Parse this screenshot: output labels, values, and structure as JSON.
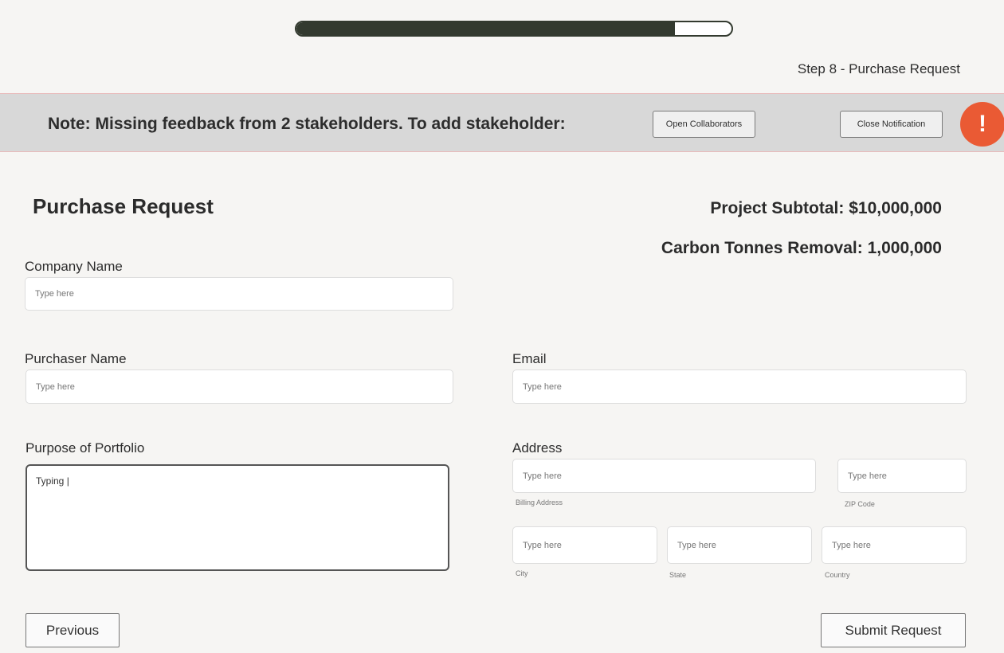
{
  "progress": {
    "fraction": 0.87
  },
  "step_label": "Step 8 - Purchase Request",
  "notification": {
    "text": "Note: Missing feedback from 2 stakeholders. To add stakeholder:",
    "open_collaborators": "Open Collaborators",
    "close_notification": "Close Notification",
    "alert_glyph": "!",
    "alert_icon": "exclamation-icon",
    "alert_color": "#ea5a34"
  },
  "form": {
    "title": "Purchase Request",
    "subtotal": "Project Subtotal: $10,000,000",
    "carbon": "Carbon Tonnes Removal: 1,000,000",
    "company_label": "Company Name",
    "purchaser_label": "Purchaser Name",
    "email_label": "Email",
    "purpose_label": "Purpose of Portfolio",
    "purpose_value": "Typing |",
    "address_label": "Address",
    "placeholder": "Type here",
    "billing_hint": "Billing Address",
    "zip_hint": "ZIP Code",
    "city_hint": "City",
    "state_hint": "State",
    "country_hint": "Country"
  },
  "buttons": {
    "previous": "Previous",
    "submit": "Submit Request"
  }
}
